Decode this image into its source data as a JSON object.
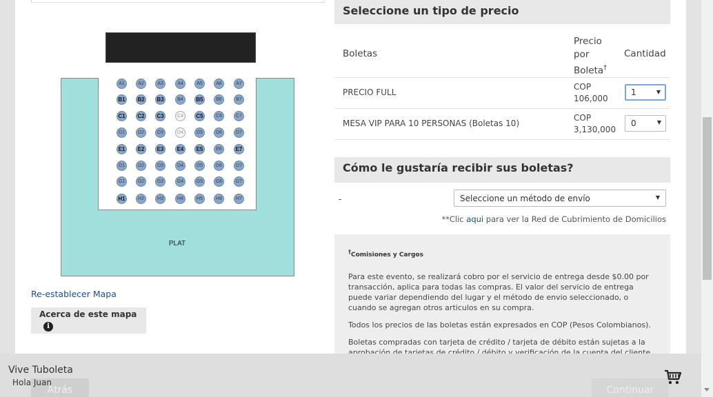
{
  "seat_map": {
    "plat_label": "PLAT",
    "reset_link": "Re-establecer Mapa",
    "about_button": "Acerca de este mapa",
    "info_icon_glyph": "i",
    "rows": [
      {
        "seats": [
          {
            "label": "A1",
            "style": "normal"
          },
          {
            "label": "A2",
            "style": "normal"
          },
          {
            "label": "A3",
            "style": "normal"
          },
          {
            "label": "A4",
            "style": "normal"
          },
          {
            "label": "A5",
            "style": "normal"
          },
          {
            "label": "A6",
            "style": "normal"
          },
          {
            "label": "A7",
            "style": "normal"
          }
        ]
      },
      {
        "seats": [
          {
            "label": "B1",
            "style": "dark"
          },
          {
            "label": "B2",
            "style": "dark"
          },
          {
            "label": "B3",
            "style": "dark"
          },
          {
            "label": "B4",
            "style": "normal"
          },
          {
            "label": "B5",
            "style": "dark"
          },
          {
            "label": "B6",
            "style": "normal"
          },
          {
            "label": "B7",
            "style": "normal"
          }
        ]
      },
      {
        "seats": [
          {
            "label": "C1",
            "style": "dark"
          },
          {
            "label": "C2",
            "style": "dark"
          },
          {
            "label": "C3",
            "style": "dark"
          },
          {
            "label": "C4",
            "style": "empty"
          },
          {
            "label": "C5",
            "style": "dark"
          },
          {
            "label": "C6",
            "style": "normal"
          },
          {
            "label": "C7",
            "style": "normal"
          }
        ]
      },
      {
        "seats": [
          {
            "label": "D1",
            "style": "normal"
          },
          {
            "label": "D2",
            "style": "normal"
          },
          {
            "label": "D3",
            "style": "normal"
          },
          {
            "label": "D4",
            "style": "empty"
          },
          {
            "label": "D5",
            "style": "normal"
          },
          {
            "label": "D6",
            "style": "normal"
          },
          {
            "label": "D7",
            "style": "normal"
          }
        ]
      },
      {
        "seats": [
          {
            "label": "E1",
            "style": "dark"
          },
          {
            "label": "E2",
            "style": "dark"
          },
          {
            "label": "E3",
            "style": "dark"
          },
          {
            "label": "E4",
            "style": "dark"
          },
          {
            "label": "E5",
            "style": "dark"
          },
          {
            "label": "E6",
            "style": "normal"
          },
          {
            "label": "E7",
            "style": "dark"
          }
        ]
      },
      {
        "seats": [
          {
            "label": "D1",
            "style": "normal"
          },
          {
            "label": "D2",
            "style": "normal"
          },
          {
            "label": "D3",
            "style": "normal"
          },
          {
            "label": "D4",
            "style": "normal"
          },
          {
            "label": "D5",
            "style": "normal"
          },
          {
            "label": "D6",
            "style": "normal"
          },
          {
            "label": "D7",
            "style": "normal"
          }
        ]
      },
      {
        "seats": [
          {
            "label": "G1",
            "style": "normal"
          },
          {
            "label": "G2",
            "style": "normal"
          },
          {
            "label": "G3",
            "style": "normal"
          },
          {
            "label": "G4",
            "style": "normal"
          },
          {
            "label": "G5",
            "style": "normal"
          },
          {
            "label": "G6",
            "style": "normal"
          },
          {
            "label": "G7",
            "style": "normal"
          }
        ]
      },
      {
        "seats": [
          {
            "label": "H1",
            "style": "dark"
          },
          {
            "label": "H2",
            "style": "normal"
          },
          {
            "label": "H3",
            "style": "normal"
          },
          {
            "label": "H4",
            "style": "normal"
          },
          {
            "label": "H5",
            "style": "normal"
          },
          {
            "label": "H6",
            "style": "normal"
          },
          {
            "label": "H7",
            "style": "normal"
          }
        ]
      }
    ]
  },
  "price_section": {
    "title": "Seleccione un tipo de precio",
    "col_tickets": "Boletas",
    "col_price_line1": "Precio",
    "col_price_line2": "por",
    "col_price_line3": "Boleta",
    "col_price_dagger": "†",
    "col_quantity": "Cantidad",
    "rows": [
      {
        "name": "PRECIO FULL",
        "currency": "COP",
        "amount": "106,000",
        "quantity": "1"
      },
      {
        "name": "MESA VIP PARA 10 PERSONAS (Boletas 10)",
        "currency": "COP",
        "amount": "3,130,000",
        "quantity": "0"
      }
    ]
  },
  "delivery_section": {
    "title": "Cómo le gustaría recibir sus boletas?",
    "label": "-",
    "select_value": "Seleccione un método de envío",
    "note_before": "**Clic ",
    "note_link": "aqui",
    "note_after": " para ver la Red de Cubrimiento de Domicilios"
  },
  "fees": {
    "dagger": "†",
    "title": "Comisiones y Cargos",
    "paragraphs": [
      "Para este evento, se realizará cobro por el servicio de entrega desde $0.00 por transacción, aplica para todas las compras. El valor del servicio de entrega puede variar dependiendo del lugar y el método de envio seleccionado, o cuando se agregan otros articulos en su compra.",
      "Todos los precios de las boletas están expresados en COP (Pesos Colombianos).",
      "Boletas compradas con tarjeta de crédito / tarjeta de débito están sujetas a la aprobación de tarjetas de crédito / débito y verificación de la cuenta del cliente."
    ]
  },
  "footer": {
    "brand": "Vive Tuboleta",
    "greeting": "Hola Juan",
    "back_button": "Atrás",
    "continue_button": "Continuar",
    "cart_icon": "shopping-cart-icon"
  },
  "colors": {
    "plat_fill": "#9fdfdc",
    "seat_fill": "#8aa7c9",
    "link": "#1f4e8c",
    "section_header_bg": "#e8e8e8"
  }
}
